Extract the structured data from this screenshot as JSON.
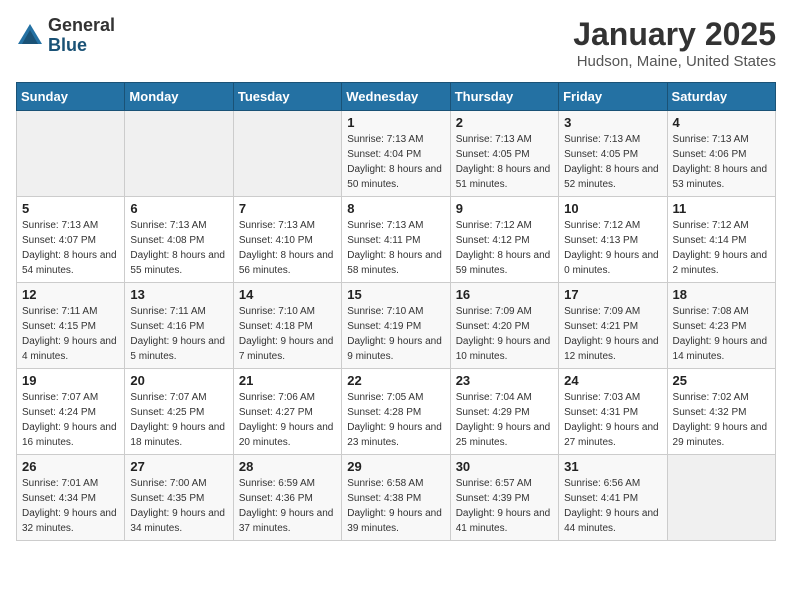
{
  "header": {
    "logo_general": "General",
    "logo_blue": "Blue",
    "title": "January 2025",
    "location": "Hudson, Maine, United States"
  },
  "weekdays": [
    "Sunday",
    "Monday",
    "Tuesday",
    "Wednesday",
    "Thursday",
    "Friday",
    "Saturday"
  ],
  "weeks": [
    [
      {
        "day": "",
        "sunrise": "",
        "sunset": "",
        "daylight": "",
        "empty": true
      },
      {
        "day": "",
        "sunrise": "",
        "sunset": "",
        "daylight": "",
        "empty": true
      },
      {
        "day": "",
        "sunrise": "",
        "sunset": "",
        "daylight": "",
        "empty": true
      },
      {
        "day": "1",
        "sunrise": "Sunrise: 7:13 AM",
        "sunset": "Sunset: 4:04 PM",
        "daylight": "Daylight: 8 hours and 50 minutes.",
        "empty": false
      },
      {
        "day": "2",
        "sunrise": "Sunrise: 7:13 AM",
        "sunset": "Sunset: 4:05 PM",
        "daylight": "Daylight: 8 hours and 51 minutes.",
        "empty": false
      },
      {
        "day": "3",
        "sunrise": "Sunrise: 7:13 AM",
        "sunset": "Sunset: 4:05 PM",
        "daylight": "Daylight: 8 hours and 52 minutes.",
        "empty": false
      },
      {
        "day": "4",
        "sunrise": "Sunrise: 7:13 AM",
        "sunset": "Sunset: 4:06 PM",
        "daylight": "Daylight: 8 hours and 53 minutes.",
        "empty": false
      }
    ],
    [
      {
        "day": "5",
        "sunrise": "Sunrise: 7:13 AM",
        "sunset": "Sunset: 4:07 PM",
        "daylight": "Daylight: 8 hours and 54 minutes.",
        "empty": false
      },
      {
        "day": "6",
        "sunrise": "Sunrise: 7:13 AM",
        "sunset": "Sunset: 4:08 PM",
        "daylight": "Daylight: 8 hours and 55 minutes.",
        "empty": false
      },
      {
        "day": "7",
        "sunrise": "Sunrise: 7:13 AM",
        "sunset": "Sunset: 4:10 PM",
        "daylight": "Daylight: 8 hours and 56 minutes.",
        "empty": false
      },
      {
        "day": "8",
        "sunrise": "Sunrise: 7:13 AM",
        "sunset": "Sunset: 4:11 PM",
        "daylight": "Daylight: 8 hours and 58 minutes.",
        "empty": false
      },
      {
        "day": "9",
        "sunrise": "Sunrise: 7:12 AM",
        "sunset": "Sunset: 4:12 PM",
        "daylight": "Daylight: 8 hours and 59 minutes.",
        "empty": false
      },
      {
        "day": "10",
        "sunrise": "Sunrise: 7:12 AM",
        "sunset": "Sunset: 4:13 PM",
        "daylight": "Daylight: 9 hours and 0 minutes.",
        "empty": false
      },
      {
        "day": "11",
        "sunrise": "Sunrise: 7:12 AM",
        "sunset": "Sunset: 4:14 PM",
        "daylight": "Daylight: 9 hours and 2 minutes.",
        "empty": false
      }
    ],
    [
      {
        "day": "12",
        "sunrise": "Sunrise: 7:11 AM",
        "sunset": "Sunset: 4:15 PM",
        "daylight": "Daylight: 9 hours and 4 minutes.",
        "empty": false
      },
      {
        "day": "13",
        "sunrise": "Sunrise: 7:11 AM",
        "sunset": "Sunset: 4:16 PM",
        "daylight": "Daylight: 9 hours and 5 minutes.",
        "empty": false
      },
      {
        "day": "14",
        "sunrise": "Sunrise: 7:10 AM",
        "sunset": "Sunset: 4:18 PM",
        "daylight": "Daylight: 9 hours and 7 minutes.",
        "empty": false
      },
      {
        "day": "15",
        "sunrise": "Sunrise: 7:10 AM",
        "sunset": "Sunset: 4:19 PM",
        "daylight": "Daylight: 9 hours and 9 minutes.",
        "empty": false
      },
      {
        "day": "16",
        "sunrise": "Sunrise: 7:09 AM",
        "sunset": "Sunset: 4:20 PM",
        "daylight": "Daylight: 9 hours and 10 minutes.",
        "empty": false
      },
      {
        "day": "17",
        "sunrise": "Sunrise: 7:09 AM",
        "sunset": "Sunset: 4:21 PM",
        "daylight": "Daylight: 9 hours and 12 minutes.",
        "empty": false
      },
      {
        "day": "18",
        "sunrise": "Sunrise: 7:08 AM",
        "sunset": "Sunset: 4:23 PM",
        "daylight": "Daylight: 9 hours and 14 minutes.",
        "empty": false
      }
    ],
    [
      {
        "day": "19",
        "sunrise": "Sunrise: 7:07 AM",
        "sunset": "Sunset: 4:24 PM",
        "daylight": "Daylight: 9 hours and 16 minutes.",
        "empty": false
      },
      {
        "day": "20",
        "sunrise": "Sunrise: 7:07 AM",
        "sunset": "Sunset: 4:25 PM",
        "daylight": "Daylight: 9 hours and 18 minutes.",
        "empty": false
      },
      {
        "day": "21",
        "sunrise": "Sunrise: 7:06 AM",
        "sunset": "Sunset: 4:27 PM",
        "daylight": "Daylight: 9 hours and 20 minutes.",
        "empty": false
      },
      {
        "day": "22",
        "sunrise": "Sunrise: 7:05 AM",
        "sunset": "Sunset: 4:28 PM",
        "daylight": "Daylight: 9 hours and 23 minutes.",
        "empty": false
      },
      {
        "day": "23",
        "sunrise": "Sunrise: 7:04 AM",
        "sunset": "Sunset: 4:29 PM",
        "daylight": "Daylight: 9 hours and 25 minutes.",
        "empty": false
      },
      {
        "day": "24",
        "sunrise": "Sunrise: 7:03 AM",
        "sunset": "Sunset: 4:31 PM",
        "daylight": "Daylight: 9 hours and 27 minutes.",
        "empty": false
      },
      {
        "day": "25",
        "sunrise": "Sunrise: 7:02 AM",
        "sunset": "Sunset: 4:32 PM",
        "daylight": "Daylight: 9 hours and 29 minutes.",
        "empty": false
      }
    ],
    [
      {
        "day": "26",
        "sunrise": "Sunrise: 7:01 AM",
        "sunset": "Sunset: 4:34 PM",
        "daylight": "Daylight: 9 hours and 32 minutes.",
        "empty": false
      },
      {
        "day": "27",
        "sunrise": "Sunrise: 7:00 AM",
        "sunset": "Sunset: 4:35 PM",
        "daylight": "Daylight: 9 hours and 34 minutes.",
        "empty": false
      },
      {
        "day": "28",
        "sunrise": "Sunrise: 6:59 AM",
        "sunset": "Sunset: 4:36 PM",
        "daylight": "Daylight: 9 hours and 37 minutes.",
        "empty": false
      },
      {
        "day": "29",
        "sunrise": "Sunrise: 6:58 AM",
        "sunset": "Sunset: 4:38 PM",
        "daylight": "Daylight: 9 hours and 39 minutes.",
        "empty": false
      },
      {
        "day": "30",
        "sunrise": "Sunrise: 6:57 AM",
        "sunset": "Sunset: 4:39 PM",
        "daylight": "Daylight: 9 hours and 41 minutes.",
        "empty": false
      },
      {
        "day": "31",
        "sunrise": "Sunrise: 6:56 AM",
        "sunset": "Sunset: 4:41 PM",
        "daylight": "Daylight: 9 hours and 44 minutes.",
        "empty": false
      },
      {
        "day": "",
        "sunrise": "",
        "sunset": "",
        "daylight": "",
        "empty": true
      }
    ]
  ]
}
